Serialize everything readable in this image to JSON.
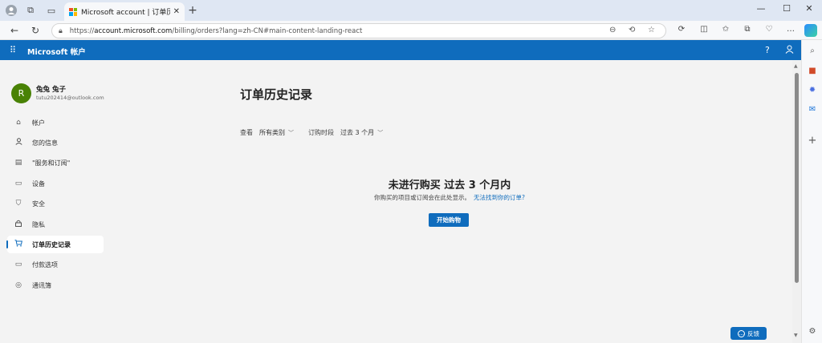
{
  "browser": {
    "tab_title": "Microsoft account | 订单历史记录",
    "url_prefix": "https://",
    "url_host": "account.microsoft.com",
    "url_rest": "/billing/orders?lang=zh-CN#main-content-landing-react"
  },
  "header": {
    "brand": "Microsoft 帐户"
  },
  "user": {
    "name": "兔兔 兔子",
    "email": "tutu202414@outlook.com",
    "initial": "R"
  },
  "sidebar": {
    "items": [
      {
        "label": "帐户",
        "icon": "home-icon"
      },
      {
        "label": "您的信息",
        "icon": "person-icon"
      },
      {
        "label": "\"服务和订阅\"",
        "icon": "subscription-icon"
      },
      {
        "label": "设备",
        "icon": "monitor-icon"
      },
      {
        "label": "安全",
        "icon": "shield-icon"
      },
      {
        "label": "隐私",
        "icon": "lock-icon"
      },
      {
        "label": "订单历史记录",
        "icon": "cart-icon",
        "active": true
      },
      {
        "label": "付款选项",
        "icon": "card-icon"
      },
      {
        "label": "通讯簿",
        "icon": "location-icon"
      }
    ]
  },
  "main": {
    "title": "订单历史记录",
    "filters": {
      "view_label": "查看",
      "category_value": "所有类别",
      "period_label": "订购时段",
      "period_value": "过去 3 个月"
    },
    "empty": {
      "title": "未进行购买 过去 3 个月内",
      "message": "你购买的项目或订阅会在此处显示。",
      "link": "无法找到你的订单?",
      "button": "开始购物"
    }
  },
  "feedback": {
    "label": "反馈"
  },
  "colors": {
    "accent": "#0f6cbd",
    "avatar": "#498205"
  }
}
